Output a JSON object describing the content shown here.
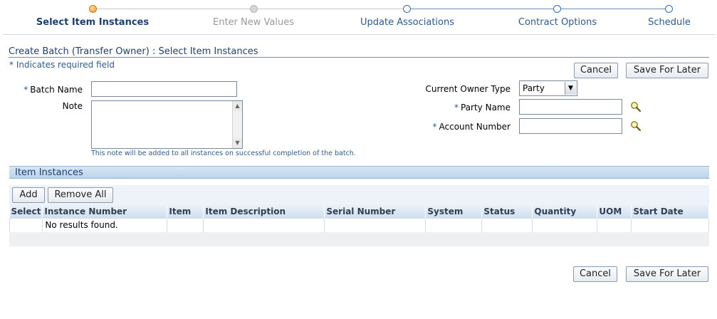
{
  "train": {
    "steps": [
      {
        "label": "Select Item Instances",
        "state": "current"
      },
      {
        "label": "Enter New Values",
        "state": "disabled"
      },
      {
        "label": "Update Associations",
        "state": "active"
      },
      {
        "label": "Contract Options",
        "state": "active"
      },
      {
        "label": "Schedule",
        "state": "active"
      }
    ]
  },
  "page": {
    "title": "Create Batch (Transfer Owner) : Select Item Instances",
    "required_note": "* Indicates required field"
  },
  "actions": {
    "cancel_label": "Cancel",
    "save_later_label": "Save For Later"
  },
  "form": {
    "batch_name": {
      "label": "Batch Name",
      "value": ""
    },
    "note": {
      "label": "Note",
      "value": "",
      "hint": "This note will be added to all instances on successful completion of the batch."
    },
    "current_owner_type": {
      "label": "Current Owner Type",
      "value": "Party"
    },
    "party_name": {
      "label": "Party Name",
      "value": ""
    },
    "account_number": {
      "label": "Account Number",
      "value": ""
    }
  },
  "item_instances": {
    "title": "Item Instances",
    "add_label": "Add",
    "remove_all_label": "Remove All",
    "columns": [
      "Select",
      "Instance Number",
      "Item",
      "Item Description",
      "Serial Number",
      "System",
      "Status",
      "Quantity",
      "UOM",
      "Start Date"
    ],
    "empty_message": "No results found."
  },
  "icons": {
    "search": "magnifier-icon"
  },
  "colors": {
    "current_step": "#f5a623",
    "active_step": "#2f6fb0",
    "disabled_step": "#c8c8c8",
    "section_bar": "#c8dbef",
    "title_text": "#1e3f6e"
  }
}
